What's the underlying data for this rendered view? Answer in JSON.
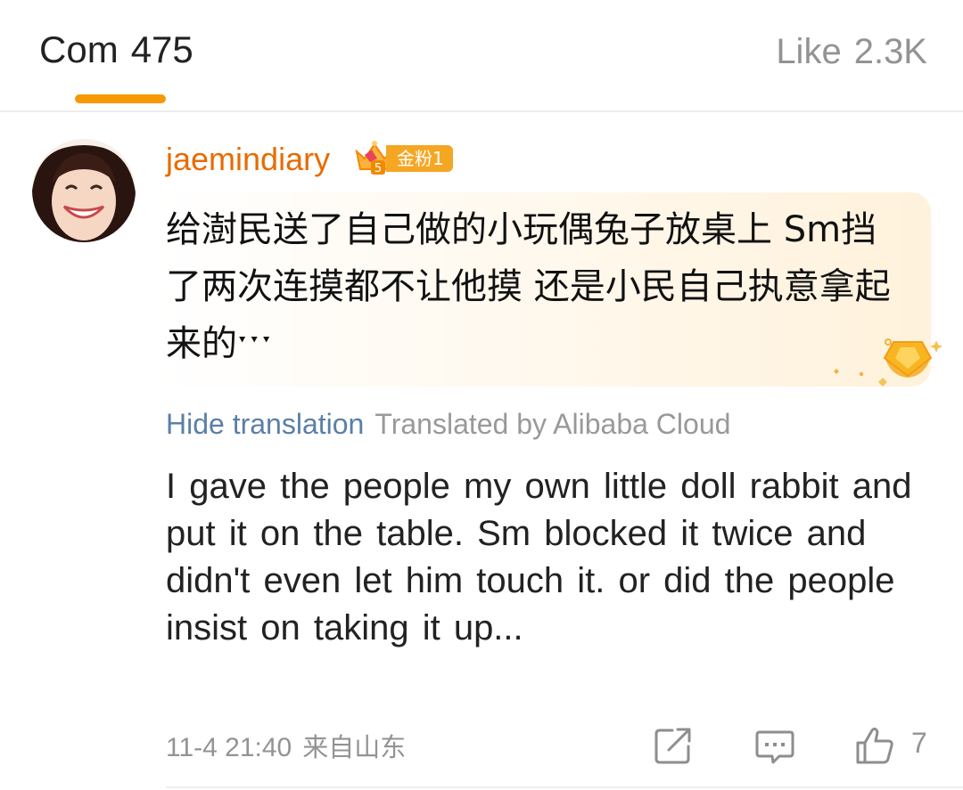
{
  "tabs": {
    "comments_label": "Com",
    "comments_count": "475",
    "likes_label": "Like",
    "likes_count": "2.3K"
  },
  "comment": {
    "username": "jaemindiary",
    "badge_level": "5",
    "badge_label": "金粉1",
    "original_text": "给澍民送了自己做的小玩偶兔子放桌上 Sm挡了两次连摸都不让他摸 还是小民自己执意拿起来的ˑˑˑ",
    "translation_toggle": "Hide translation",
    "translation_source": "Translated by Alibaba Cloud",
    "translated_text": "I gave the people my own little doll rabbit and put it on the table. Sm blocked it twice and didn't even let him touch it. or did the people insist on taking it up...",
    "timestamp": "11-4 21:40",
    "location": "来自山东",
    "like_count": "7"
  },
  "icons": {
    "repost": "edit-share-icon",
    "reply": "comment-icon",
    "like": "thumbs-up-icon",
    "badge": "crown-icon"
  },
  "colors": {
    "accent_orange": "#f59a05",
    "username": "#e86b00",
    "link_blue": "#5b7fa6",
    "muted_gray": "#939393",
    "badge_gold": "#f5a623"
  }
}
